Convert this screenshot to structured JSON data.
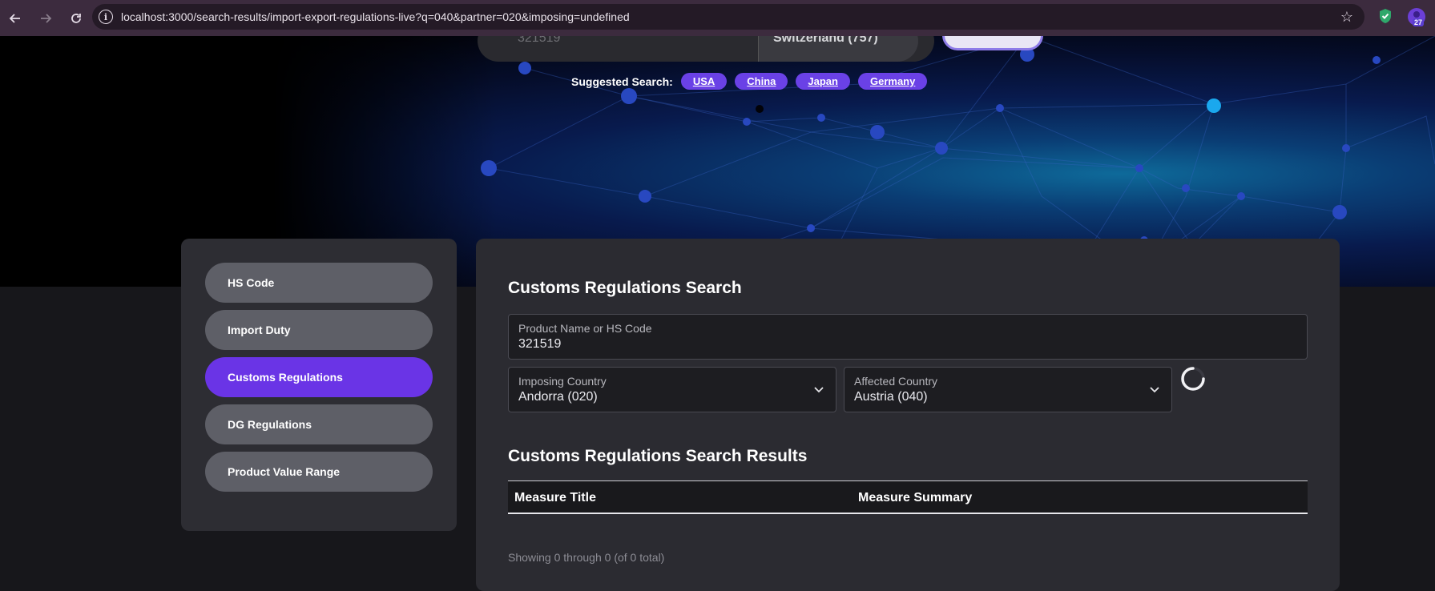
{
  "browser": {
    "url": "localhost:3000/search-results/import-export-regulations-live?q=040&partner=020&imposing=undefined",
    "extension_badge": "27"
  },
  "hero": {
    "search_value": "321519",
    "search_country": "Switzerland (757)",
    "suggested_label": "Suggested Search:",
    "suggestions": [
      "USA",
      "China",
      "Japan",
      "Germany"
    ]
  },
  "sidebar": {
    "items": [
      {
        "label": "HS Code",
        "active": false
      },
      {
        "label": "Import Duty",
        "active": false
      },
      {
        "label": "Customs Regulations",
        "active": true
      },
      {
        "label": "DG Regulations",
        "active": false
      },
      {
        "label": "Product Value Range",
        "active": false
      }
    ]
  },
  "main": {
    "title": "Customs Regulations Search",
    "product_field": {
      "label": "Product Name or HS Code",
      "value": "321519"
    },
    "imposing_country": {
      "label": "Imposing Country",
      "value": "Andorra (020)"
    },
    "affected_country": {
      "label": "Affected Country",
      "value": "Austria (040)"
    },
    "results_title": "Customs Regulations Search Results",
    "columns": [
      "Measure Title",
      "Measure Summary"
    ],
    "showing": "Showing 0 through 0 (of 0 total)"
  },
  "colors": {
    "accent": "#6a34e6",
    "chip": "#6a41e6",
    "panel": "#2b2b31",
    "page_bg": "#17171b"
  }
}
